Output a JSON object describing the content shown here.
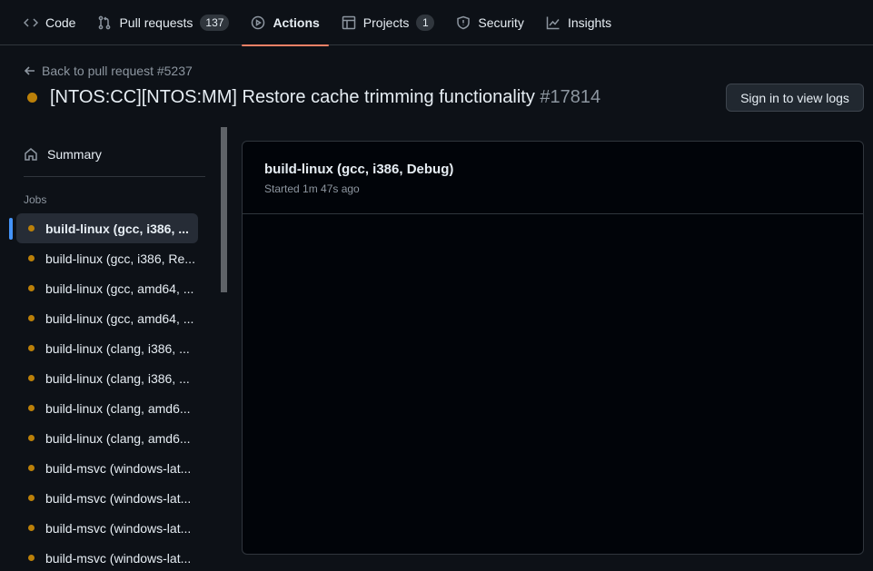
{
  "nav": {
    "tabs": [
      {
        "label": "Code",
        "icon": "code-icon"
      },
      {
        "label": "Pull requests",
        "icon": "pull-request-icon",
        "count": "137"
      },
      {
        "label": "Actions",
        "icon": "play-icon",
        "active": true
      },
      {
        "label": "Projects",
        "icon": "table-icon",
        "count": "1"
      },
      {
        "label": "Security",
        "icon": "shield-icon"
      },
      {
        "label": "Insights",
        "icon": "graph-icon"
      }
    ]
  },
  "header": {
    "back_link": "Back to pull request #5237",
    "title": "[NTOS:CC][NTOS:MM] Restore cache trimming functionality",
    "run_number": "#17814",
    "signin_label": "Sign in to view logs",
    "status_color": "#bb8009"
  },
  "sidebar": {
    "summary_label": "Summary",
    "jobs_heading": "Jobs",
    "jobs": [
      "build-linux (gcc, i386, ...",
      "build-linux (gcc, i386, Re...",
      "build-linux (gcc, amd64, ...",
      "build-linux (gcc, amd64, ...",
      "build-linux (clang, i386, ...",
      "build-linux (clang, i386, ...",
      "build-linux (clang, amd6...",
      "build-linux (clang, amd6...",
      "build-msvc (windows-lat...",
      "build-msvc (windows-lat...",
      "build-msvc (windows-lat...",
      "build-msvc (windows-lat..."
    ]
  },
  "job_panel": {
    "title": "build-linux (gcc, i386, Debug)",
    "subtitle": "Started 1m 47s ago"
  },
  "colors": {
    "accent_underline": "#f78166",
    "selected_indicator": "#4493f8",
    "in_progress": "#bb8009"
  }
}
